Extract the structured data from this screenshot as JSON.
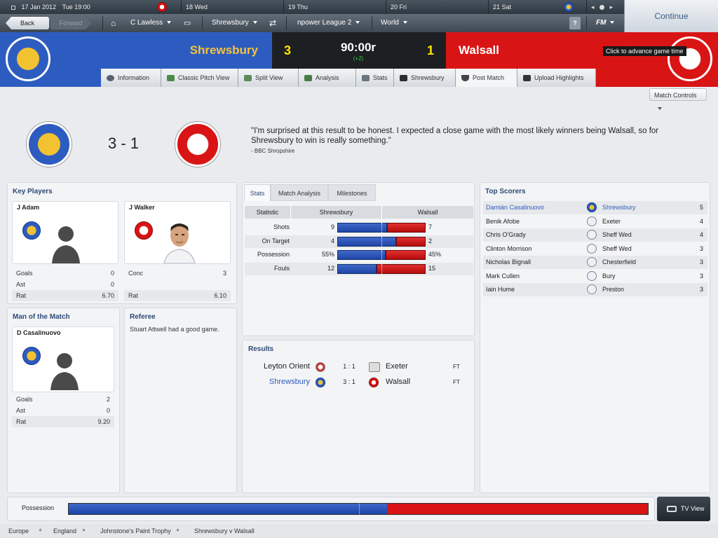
{
  "calendar": {
    "current_date": "17 Jan 2012",
    "current_day_time": "Tue 19:00",
    "days": [
      "18 Wed",
      "19 Thu",
      "20 Fri",
      "21 Sat"
    ]
  },
  "nav": {
    "back": "Back",
    "forward": "Forward",
    "manager": "C Lawless",
    "club": "Shrewsbury",
    "competition": "npower League 2",
    "world": "World",
    "help": "?",
    "fm": "FM"
  },
  "continue_label": "Continue",
  "tooltip": "Click to advance game time",
  "score_header": {
    "home_team": "Shrewsbury",
    "away_team": "Walsall",
    "home_score": "3",
    "away_score": "1",
    "clock": "90:00r",
    "added_time": "(+2)"
  },
  "tabs": [
    {
      "label": "Information"
    },
    {
      "label": "Classic Pitch View"
    },
    {
      "label": "Split View"
    },
    {
      "label": "Analysis"
    },
    {
      "label": "Stats"
    },
    {
      "label": "Shrewsbury"
    },
    {
      "label": "Post Match"
    },
    {
      "label": "Upload Highlights"
    }
  ],
  "match_controls": "Match Controls",
  "result": {
    "score": "3 - 1",
    "quote": "\"I'm surprised at this result to be honest. I expected a close game with the most likely winners being Walsall, so for Shrewsbury to win is really something.\"",
    "source": "- BBC Shropshire"
  },
  "key_players": {
    "title": "Key Players",
    "home": {
      "name": "J Adam",
      "rows": [
        {
          "label": "Goals",
          "value": "0"
        },
        {
          "label": "Ast",
          "value": "0"
        },
        {
          "label": "Rat",
          "value": "6.70"
        }
      ]
    },
    "away": {
      "name": "J Walker",
      "rows": [
        {
          "label": "Conc",
          "value": "3"
        },
        {
          "label": "Rat",
          "value": "6.10"
        }
      ]
    }
  },
  "motm": {
    "title": "Man of the Match",
    "name": "D Casalinuovo",
    "rows": [
      {
        "label": "Goals",
        "value": "2"
      },
      {
        "label": "Ast",
        "value": "0"
      },
      {
        "label": "Rat",
        "value": "9.20"
      }
    ]
  },
  "referee": {
    "title": "Referee",
    "text": "Stuart Attwell had a good game."
  },
  "stats_tabs": [
    "Stats",
    "Match Analysis",
    "Milestones"
  ],
  "stats": {
    "headers": [
      "Statistic",
      "Shrewsbury",
      "Walsall"
    ],
    "rows": [
      {
        "label": "Shots",
        "home": "9",
        "away": "7",
        "home_share": 0.5625
      },
      {
        "label": "On Target",
        "home": "4",
        "away": "2",
        "home_share": 0.6667
      },
      {
        "label": "Possession",
        "home": "55%",
        "away": "45%",
        "home_share": 0.55
      },
      {
        "label": "Fouls",
        "home": "12",
        "away": "15",
        "home_share": 0.4444
      }
    ]
  },
  "results": {
    "title": "Results",
    "rows": [
      {
        "home": "Leyton Orient",
        "score": "1 : 1",
        "away": "Exeter",
        "status": "FT"
      },
      {
        "home": "Shrewsbury",
        "score": "3 : 1",
        "away": "Walsall",
        "status": "FT"
      }
    ]
  },
  "top_scorers": {
    "title": "Top Scorers",
    "rows": [
      {
        "name": "Damián Casalinuovo",
        "club": "Shrewsbury",
        "goals": "5"
      },
      {
        "name": "Benik Afobe",
        "club": "Exeter",
        "goals": "4"
      },
      {
        "name": "Chris O'Grady",
        "club": "Sheff Wed",
        "goals": "4"
      },
      {
        "name": "Clinton Morrison",
        "club": "Sheff Wed",
        "goals": "3"
      },
      {
        "name": "Nicholas Bignall",
        "club": "Chesterfield",
        "goals": "3"
      },
      {
        "name": "Mark Cullen",
        "club": "Bury",
        "goals": "3"
      },
      {
        "name": "Iain Hume",
        "club": "Preston",
        "goals": "3"
      }
    ]
  },
  "possession_bar": {
    "label": "Possession",
    "home_share": 0.55
  },
  "tv_view": "TV View",
  "breadcrumb": [
    "Europe",
    "England",
    "Johnstone's Paint Trophy",
    "Shrewsbury v Walsall"
  ],
  "colors": {
    "home": "#2d5cc0",
    "away": "#d91414",
    "accent_text": "#2c4a75"
  }
}
